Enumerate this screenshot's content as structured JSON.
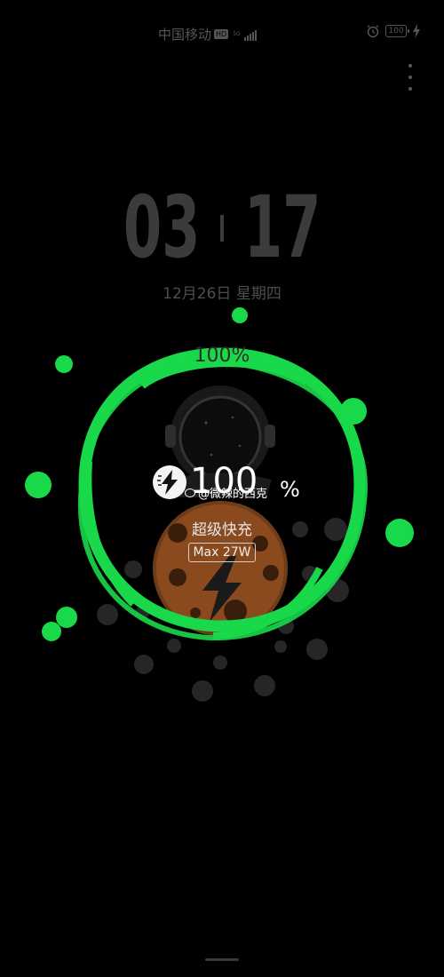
{
  "status_bar": {
    "carrier": "中国移动",
    "hd_badge": "HD",
    "network_type": "5G",
    "network_sub": "",
    "battery_level": "100",
    "icons": [
      "signal-icon",
      "alarm-icon",
      "battery-icon",
      "charging-icon"
    ]
  },
  "lock_screen": {
    "hours": "03",
    "minutes": "17",
    "date": "12月26日 星期四",
    "menu_icon": "more-vertical-icon"
  },
  "charging": {
    "top_percent": "100%",
    "percent_number": "100",
    "percent_sign": "%",
    "watermark": "@微辣的西克",
    "mode": "超级快充",
    "max_power": "Max 27W",
    "progress": 1.0,
    "colors": {
      "ring": "#19d84a",
      "planet": "#8b4a1e",
      "bolt": "#1a1a1a"
    }
  }
}
